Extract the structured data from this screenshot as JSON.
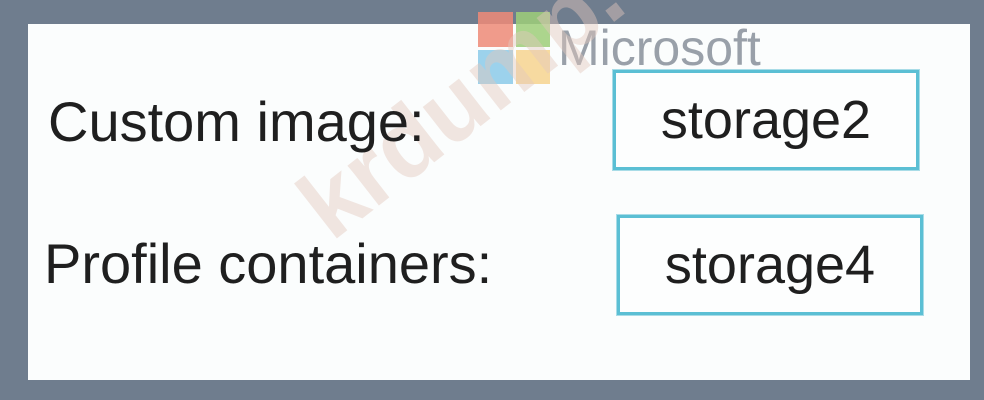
{
  "logo": {
    "text": "Microsoft",
    "colors": [
      "#f25022",
      "#7fba00",
      "#00a4ef",
      "#ffb900"
    ]
  },
  "watermark": "krdump.com",
  "rows": [
    {
      "label": "Custom image:",
      "value": "storage2"
    },
    {
      "label": "Profile containers:",
      "value": "storage4"
    }
  ]
}
